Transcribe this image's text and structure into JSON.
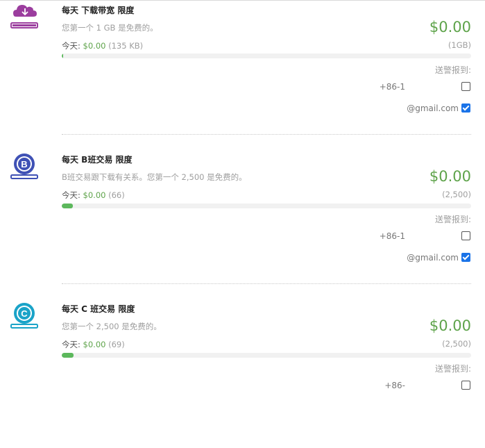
{
  "sections": [
    {
      "title": "每天 下载带宽 限度",
      "description": "您第一个 1 GB 是免费的。",
      "price": "$0.00",
      "today_label": "今天:",
      "today_amount": "$0.00",
      "today_count": "(135 KB)",
      "limit": "(1GB)",
      "usage_fraction": 0.002,
      "alert_label": "送警报到:",
      "phone": "+86-1",
      "phone_checked": false,
      "email": "@gmail.com",
      "email_checked": true,
      "icon": "cloud-download-icon",
      "icon_color": "#9b3d9e"
    },
    {
      "title": "每天 B班交易 限度",
      "description": "B班交易跟下载有关系。您第一个 2,500 是免费的。",
      "price": "$0.00",
      "today_label": "今天:",
      "today_amount": "$0.00",
      "today_count": "(66)",
      "limit": "(2,500)",
      "usage_fraction": 0.026,
      "alert_label": "送警报到:",
      "phone": "+86-1",
      "phone_checked": false,
      "email": "@gmail.com",
      "email_checked": true,
      "icon": "class-b-transaction-icon",
      "icon_color": "#3f51b5"
    },
    {
      "title": "每天 C 班交易 限度",
      "description": "您第一个 2,500 是免费的。",
      "price": "$0.00",
      "today_label": "今天:",
      "today_amount": "$0.00",
      "today_count": "(69)",
      "limit": "(2,500)",
      "usage_fraction": 0.028,
      "alert_label": "送警报到:",
      "phone": "+86-",
      "phone_checked": false,
      "icon": "class-c-transaction-icon",
      "icon_color": "#1aa3c8"
    }
  ]
}
